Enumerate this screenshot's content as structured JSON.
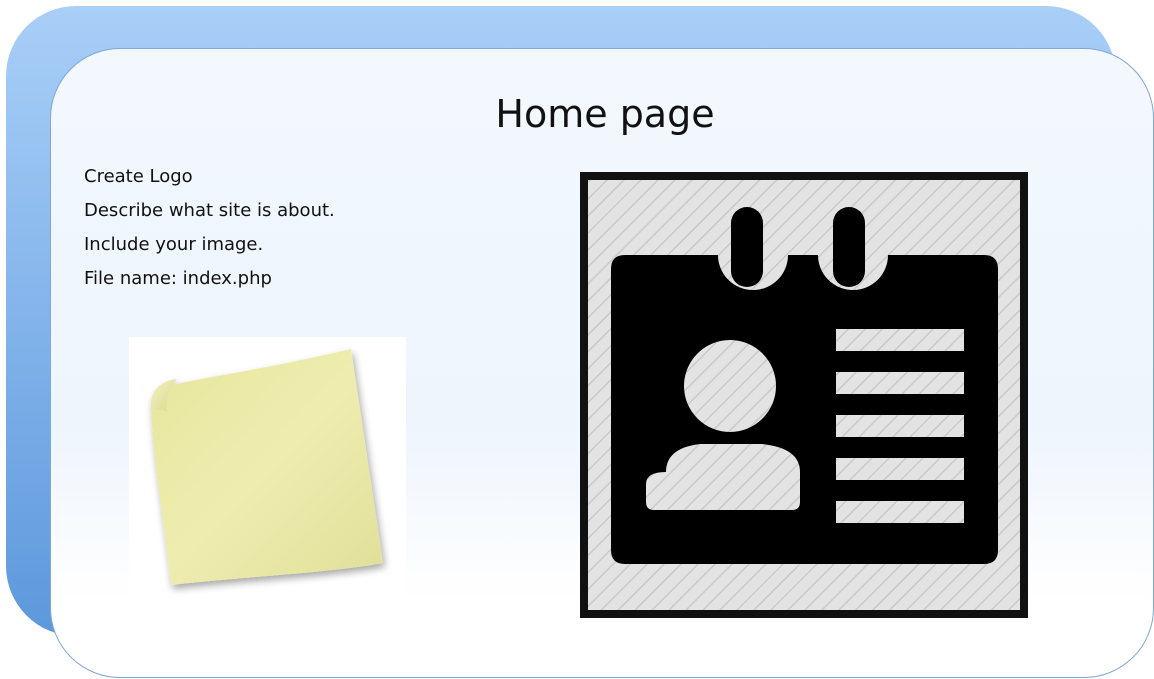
{
  "slide": {
    "title": "Home page",
    "items": [
      "Create Logo",
      "Describe what site is about.",
      "Include your image.",
      "File name: index.php"
    ]
  },
  "images": {
    "sticky_note": "sticky-note-photo",
    "id_badge": "id-badge-icon"
  },
  "colors": {
    "back_panel": "#86b6ec",
    "front_panel": "#f3f8fe",
    "sticky_note": "#ebeaa6",
    "badge_fill": "#000000",
    "badge_background": "#dcdcdc"
  }
}
